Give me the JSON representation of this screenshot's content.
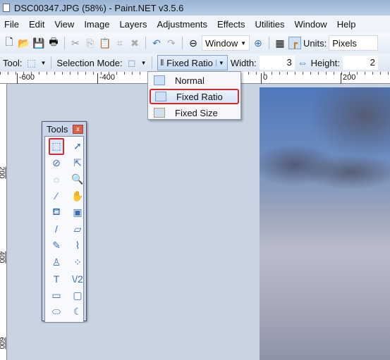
{
  "window": {
    "title": "DSC00347.JPG (58%) - Paint.NET v3.5.6"
  },
  "menu": [
    "File",
    "Edit",
    "View",
    "Image",
    "Layers",
    "Adjustments",
    "Effects",
    "Utilities",
    "Window",
    "Help"
  ],
  "toolbar": {
    "zoom_value": "Window",
    "units_label": "Units:",
    "units_value": "Pixels"
  },
  "tool_options": {
    "tool_label": "Tool:",
    "selection_mode_label": "Selection Mode:",
    "mode_value": "Fixed Ratio",
    "width_label": "Width:",
    "width_value": "3",
    "height_label": "Height:",
    "height_value": "2"
  },
  "dropdown": {
    "items": [
      "Normal",
      "Fixed Ratio",
      "Fixed Size"
    ],
    "selected": "Fixed Ratio"
  },
  "rulers": {
    "horizontal": [
      "-600",
      "-400",
      "0",
      "200"
    ],
    "vertical": [
      "200",
      "400",
      "600"
    ]
  },
  "tools": {
    "title": "Tools",
    "close": "x",
    "items": [
      "rectangle-select",
      "move-selected",
      "lasso-select",
      "move-selection",
      "ellipse-select",
      "zoom",
      "magic-wand",
      "pan",
      "paint-bucket",
      "gradient",
      "paintbrush",
      "eraser",
      "pencil",
      "color-picker",
      "clone-stamp",
      "recolor",
      "text",
      "line-curve",
      "rectangle",
      "rounded-rectangle",
      "ellipse",
      "freeform-shape"
    ],
    "glyphs": [
      "⬚",
      "➚",
      "⊘",
      "⇱",
      "◌",
      "🔍",
      "⁄",
      "✋",
      "⛾",
      "▣",
      "/",
      "▱",
      "✎",
      "⌇",
      "♙",
      "⁘",
      "T",
      "\\/2",
      "▭",
      "▢",
      "⬭",
      "☾"
    ],
    "active": "rectangle-select"
  },
  "colors": {
    "accent": "#d42a2a",
    "canvas_bg": "#c9d4e3"
  }
}
